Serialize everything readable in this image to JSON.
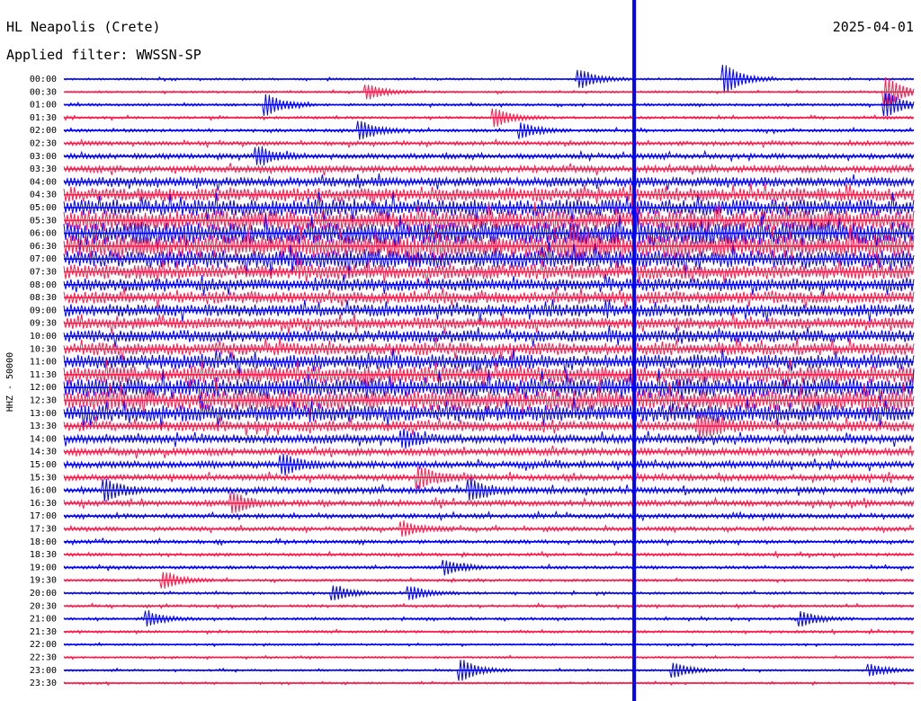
{
  "chart_data": {
    "type": "line",
    "title": "HL Neapolis (Crete)",
    "subtitle": "Applied filter: WWSSN-SP",
    "date": "2025-04-01",
    "ylabel": "HHZ - 50000",
    "colors": [
      "#0000ff",
      "#ff1a4a"
    ],
    "row_labels": [
      "00:00",
      "00:30",
      "01:00",
      "01:30",
      "02:00",
      "02:30",
      "03:00",
      "03:30",
      "04:00",
      "04:30",
      "05:00",
      "05:30",
      "06:00",
      "06:30",
      "07:00",
      "07:30",
      "08:00",
      "08:30",
      "09:00",
      "09:30",
      "10:00",
      "10:30",
      "11:00",
      "11:30",
      "12:00",
      "12:30",
      "13:00",
      "13:30",
      "14:00",
      "14:30",
      "15:00",
      "15:30",
      "16:00",
      "16:30",
      "17:00",
      "17:30",
      "18:00",
      "18:30",
      "19:00",
      "19:30",
      "20:00",
      "20:30",
      "21:00",
      "21:30",
      "22:00",
      "22:30",
      "23:00",
      "23:30"
    ],
    "noise_level": [
      0.4,
      0.4,
      0.5,
      0.5,
      0.6,
      0.8,
      1.0,
      1.3,
      1.8,
      2.6,
      3.2,
      3.8,
      4.2,
      4.4,
      3.4,
      2.8,
      2.5,
      2.3,
      2.4,
      2.2,
      2.3,
      2.4,
      2.8,
      3.2,
      3.6,
      3.8,
      3.2,
      2.0,
      1.6,
      1.4,
      1.3,
      1.2,
      1.2,
      1.1,
      0.9,
      0.8,
      0.7,
      0.6,
      0.6,
      0.5,
      0.5,
      0.5,
      0.5,
      0.5,
      0.4,
      0.4,
      0.4,
      0.4
    ],
    "events": [
      {
        "row": 0,
        "t": 0.61,
        "amp": 1.5
      },
      {
        "row": 0,
        "t": 0.78,
        "amp": 2.5
      },
      {
        "row": 1,
        "t": 0.36,
        "amp": 1.2
      },
      {
        "row": 1,
        "t": 0.97,
        "amp": 2.5
      },
      {
        "row": 2,
        "t": 0.24,
        "amp": 1.8
      },
      {
        "row": 2,
        "t": 0.97,
        "amp": 2.0
      },
      {
        "row": 3,
        "t": 0.51,
        "amp": 1.5
      },
      {
        "row": 4,
        "t": 0.35,
        "amp": 1.6
      },
      {
        "row": 4,
        "t": 0.54,
        "amp": 1.2
      },
      {
        "row": 6,
        "t": 0.23,
        "amp": 1.4
      },
      {
        "row": 13,
        "t": 0.6,
        "amp": 2.0
      },
      {
        "row": 27,
        "t": 0.75,
        "amp": 1.8
      },
      {
        "row": 28,
        "t": 0.4,
        "amp": 1.2
      },
      {
        "row": 30,
        "t": 0.26,
        "amp": 1.5
      },
      {
        "row": 31,
        "t": 0.42,
        "amp": 1.6
      },
      {
        "row": 32,
        "t": 0.05,
        "amp": 1.6
      },
      {
        "row": 32,
        "t": 0.48,
        "amp": 1.6
      },
      {
        "row": 33,
        "t": 0.2,
        "amp": 1.5
      },
      {
        "row": 35,
        "t": 0.4,
        "amp": 1.2
      },
      {
        "row": 38,
        "t": 0.45,
        "amp": 1.2
      },
      {
        "row": 39,
        "t": 0.12,
        "amp": 1.4
      },
      {
        "row": 40,
        "t": 0.32,
        "amp": 1.2
      },
      {
        "row": 40,
        "t": 0.41,
        "amp": 1.1
      },
      {
        "row": 42,
        "t": 0.1,
        "amp": 1.2
      },
      {
        "row": 42,
        "t": 0.87,
        "amp": 1.2
      },
      {
        "row": 46,
        "t": 0.47,
        "amp": 1.8
      },
      {
        "row": 46,
        "t": 0.72,
        "amp": 1.2
      },
      {
        "row": 46,
        "t": 0.95,
        "amp": 1.0
      }
    ],
    "spike_t": 0.671
  }
}
